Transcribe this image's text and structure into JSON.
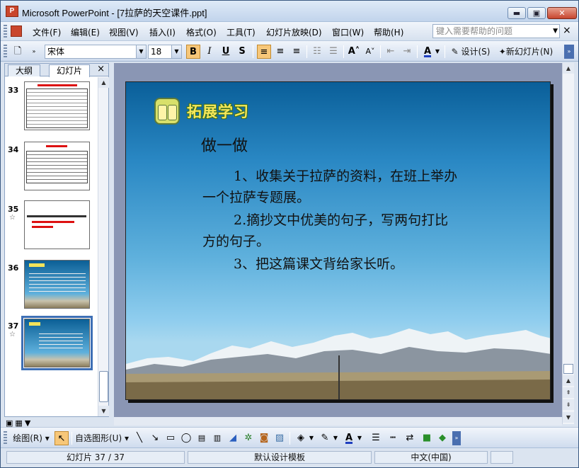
{
  "window": {
    "title": "Microsoft PowerPoint - [7拉萨的天空课件.ppt]",
    "app_icon": "powerpoint-icon",
    "controls": [
      "minimize-icon",
      "restore-icon",
      "close-icon"
    ]
  },
  "menubar": {
    "items": [
      "文件(F)",
      "编辑(E)",
      "视图(V)",
      "插入(I)",
      "格式(O)",
      "工具(T)",
      "幻灯片放映(D)",
      "窗口(W)",
      "帮助(H)"
    ],
    "help_placeholder": "键入需要帮助的问题",
    "close_symbol": "×"
  },
  "toolbar": {
    "font_name": "宋体",
    "font_size": "18",
    "bold": "B",
    "italic": "I",
    "underline": "U",
    "shadow": "S",
    "design_label": "设计(S)",
    "new_slide_label": "新幻灯片(N)"
  },
  "left_pane": {
    "tabs": [
      "大纲",
      "幻灯片"
    ],
    "selected_tab": "幻灯片",
    "close_symbol": "×",
    "thumbnails": [
      {
        "number": "33",
        "has_star": false
      },
      {
        "number": "34",
        "has_star": false
      },
      {
        "number": "35",
        "has_star": true
      },
      {
        "number": "36",
        "has_star": false
      },
      {
        "number": "37",
        "has_star": true,
        "selected": true
      }
    ],
    "star_symbol": "☆"
  },
  "slide": {
    "title": "拓展学习",
    "heading": "做一做",
    "lines": [
      "1、收集关于拉萨的资料，在班上举办",
      "一个拉萨专题展。",
      "2.摘抄文中优美的句子，写两句打比",
      "方的句子。",
      "3、把这篇课文背给家长听。"
    ]
  },
  "drawbar": {
    "draw_label": "绘图(R)",
    "autoshape_label": "自选图形(U)"
  },
  "statusbar": {
    "slide_position": "幻灯片 37 / 37",
    "template": "默认设计模板",
    "language": "中文(中国)"
  },
  "colors": {
    "title_yellow": "#f7e85a",
    "selection_blue": "#3e6fb5",
    "sky_top": "#0a5f99",
    "sky_bottom": "#a9d8ef"
  }
}
